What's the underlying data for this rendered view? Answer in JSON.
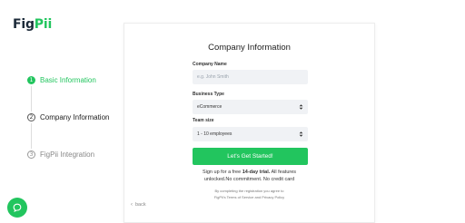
{
  "brand": {
    "logo_fig": "Fig",
    "logo_pii": "Pii",
    "accent": "#22c55e"
  },
  "steps": [
    {
      "num": "1",
      "label": "Basic Information",
      "state": "done"
    },
    {
      "num": "2",
      "label": "Company Information",
      "state": "current"
    },
    {
      "num": "3",
      "label": "FigPii Integration",
      "state": "upcoming"
    }
  ],
  "form": {
    "title": "Company Information",
    "company_name": {
      "label": "Company Name",
      "placeholder": "e.g. John Smith",
      "value": ""
    },
    "business_type": {
      "label": "Business Type",
      "value": "eCommerce"
    },
    "team_size": {
      "label": "Team size",
      "value": "1 - 10 employees"
    },
    "submit_label": "Let's Get Started!",
    "trial_pre": "Sign up for a free ",
    "trial_bold": "14-day trial.",
    "trial_post": " All features",
    "trial_line2": "unlocked.No commitment. No credit card",
    "terms_line1": "By completing the registration you agree to",
    "terms_line2": "FigPii's Terms of Service and Privacy Policy",
    "back_label": "back",
    "back_icon": "chevron-left-icon"
  },
  "chat": {
    "icon": "chat-bubble-icon"
  }
}
